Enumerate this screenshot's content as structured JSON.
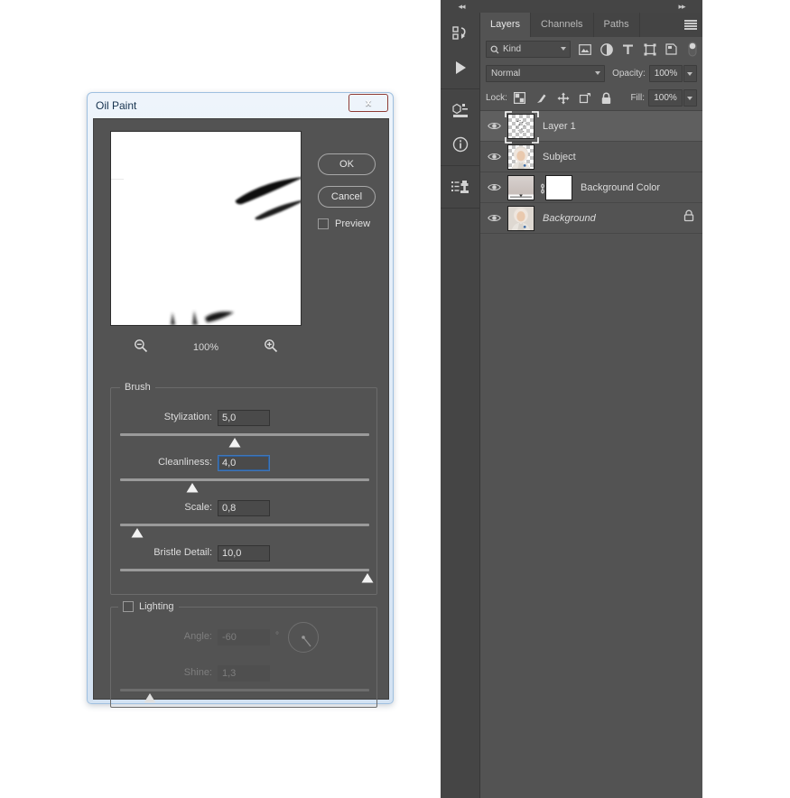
{
  "dialog": {
    "title": "Oil Paint",
    "close_label": "x",
    "buttons": {
      "ok": "OK",
      "cancel": "Cancel"
    },
    "preview_checkbox": {
      "label": "Preview",
      "checked": false
    },
    "zoom": {
      "value": "100%",
      "out_icon": "zoom-out-icon",
      "in_icon": "zoom-in-icon"
    },
    "brush_group": {
      "title": "Brush",
      "controls": [
        {
          "label": "Stylization:",
          "value": "5,0",
          "slider_pct": 46,
          "focused": false
        },
        {
          "label": "Cleanliness:",
          "value": "4,0",
          "slider_pct": 29,
          "focused": true
        },
        {
          "label": "Scale:",
          "value": "0,8",
          "slider_pct": 7,
          "focused": false
        },
        {
          "label": "Bristle Detail:",
          "value": "10,0",
          "slider_pct": 100,
          "focused": false
        }
      ]
    },
    "lighting_group": {
      "title": "Lighting",
      "checked": false,
      "enabled": false,
      "angle": {
        "label": "Angle:",
        "value": "-60",
        "unit": "°"
      },
      "shine": {
        "label": "Shine:",
        "value": "1,3",
        "slider_pct": 12
      }
    }
  },
  "panel": {
    "collapse_left_icon": "chevron-double-left-icon",
    "collapse_right_icon": "chevron-double-right-icon",
    "rail_items": [
      {
        "name": "history-icon"
      },
      {
        "name": "play-icon"
      },
      {
        "name": "properties-icon"
      },
      {
        "name": "info-icon"
      },
      {
        "name": "clone-source-icon"
      }
    ],
    "tabs": [
      {
        "label": "Layers",
        "active": true
      },
      {
        "label": "Channels",
        "active": false
      },
      {
        "label": "Paths",
        "active": false
      }
    ],
    "menu_icon": "hamburger-menu-icon",
    "filter": {
      "kind_label": "Kind",
      "search_icon": "search-icon",
      "icons": [
        "pixel-filter-icon",
        "adjustment-filter-icon",
        "type-filter-icon",
        "shape-filter-icon",
        "smart-object-filter-icon"
      ],
      "toggle_icon": "filter-toggle-icon"
    },
    "blend": {
      "mode": "Normal",
      "opacity_label": "Opacity:",
      "opacity_value": "100%"
    },
    "lock": {
      "label": "Lock:",
      "icons": [
        "lock-transparency-icon",
        "lock-image-icon",
        "lock-position-icon",
        "lock-artboard-icon",
        "lock-all-icon"
      ],
      "fill_label": "Fill:",
      "fill_value": "100%"
    },
    "layers": [
      {
        "name": "Layer 1",
        "selected": true,
        "italic": false,
        "visible": true,
        "type": "transparent",
        "locked": false,
        "has_mask": false
      },
      {
        "name": "Subject",
        "selected": false,
        "italic": false,
        "visible": true,
        "type": "portrait-transparent",
        "locked": false,
        "has_mask": false
      },
      {
        "name": "Background Color",
        "selected": false,
        "italic": false,
        "visible": true,
        "type": "fill",
        "locked": false,
        "has_mask": true,
        "link_icon": "link-icon"
      },
      {
        "name": "Background",
        "selected": false,
        "italic": true,
        "visible": true,
        "type": "portrait",
        "locked": true,
        "lock_icon": "lock-icon"
      }
    ]
  },
  "colors": {
    "panel_bg": "#535353",
    "rail_bg": "#454545",
    "selected_row": "#5f5f5f",
    "accent_focus": "#3f76b8",
    "close_red": "#b03832",
    "aero_frame": "#dfeaf6"
  }
}
